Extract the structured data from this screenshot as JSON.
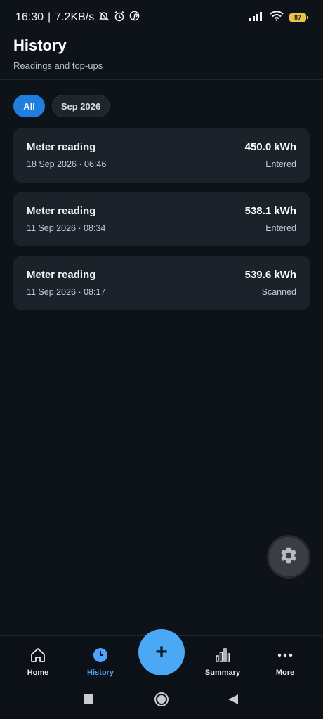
{
  "status_bar": {
    "time": "16:30",
    "separator": "|",
    "network_speed": "7.2KB/s",
    "battery_level": "87",
    "icons": [
      "mute-bell-icon",
      "alarm-icon",
      "pinterest-icon",
      "signal-icon",
      "wifi-icon",
      "battery-icon"
    ]
  },
  "header": {
    "title": "History",
    "subtitle": "Readings and top-ups"
  },
  "filters": [
    {
      "label": "All",
      "selected": true
    },
    {
      "label": "Sep 2026",
      "selected": false
    }
  ],
  "readings": [
    {
      "title": "Meter reading",
      "date": "18 Sep 2026 · 06:46",
      "value": "450.0 kWh",
      "source": "Entered"
    },
    {
      "title": "Meter reading",
      "date": "11 Sep 2026 · 08:34",
      "value": "538.1 kWh",
      "source": "Entered"
    },
    {
      "title": "Meter reading",
      "date": "11 Sep 2026 · 08:17",
      "value": "539.6 kWh",
      "source": "Scanned"
    }
  ],
  "bottom_nav": {
    "home": "Home",
    "history": "History",
    "add": "+",
    "summary": "Summary",
    "more": "More",
    "active": "history"
  },
  "colors": {
    "background": "#0e131a",
    "card": "#1c222a",
    "accent": "#1f7fe0",
    "fab": "#4aa8f5",
    "active_nav": "#4fa3ff"
  }
}
